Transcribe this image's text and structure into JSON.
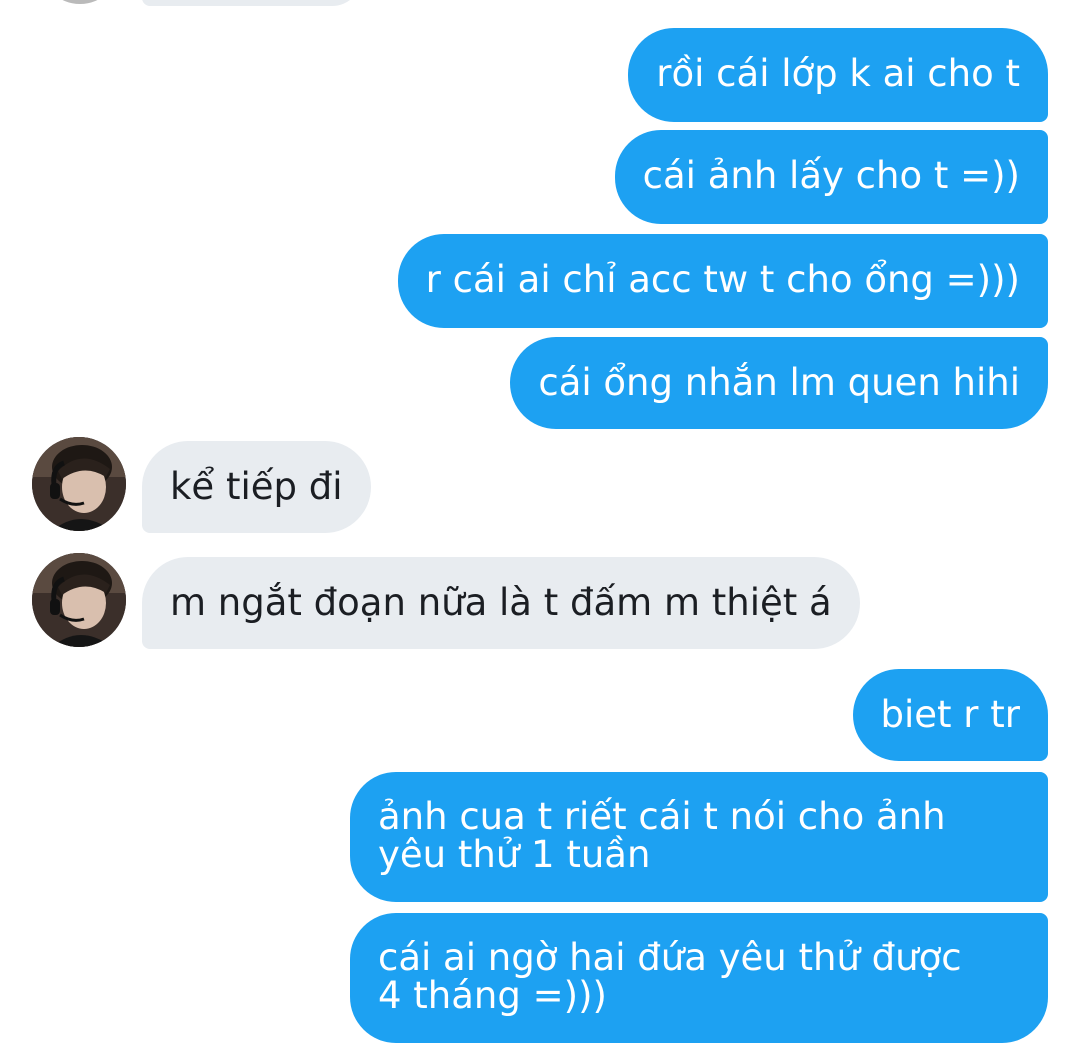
{
  "conversation": {
    "messages": [
      {
        "id": "m1",
        "side": "out",
        "text": "rồi cái lớp k ai cho t"
      },
      {
        "id": "m2",
        "side": "out",
        "text": "cái ảnh lấy cho t =))"
      },
      {
        "id": "m3",
        "side": "out",
        "text": "r cái ai chỉ acc tw t cho ổng =)))"
      },
      {
        "id": "m4",
        "side": "out",
        "text": "cái ổng nhắn lm quen hihi"
      },
      {
        "id": "m5",
        "side": "in",
        "text": "kể tiếp đi"
      },
      {
        "id": "m6",
        "side": "in",
        "text": "m ngắt đoạn nữa là t đấm m thiệt á"
      },
      {
        "id": "m7",
        "side": "out",
        "text": "biet r tr"
      },
      {
        "id": "m8",
        "side": "out",
        "text": "ảnh  cua t riết cái t nói cho ảnh yêu thử 1 tuần"
      },
      {
        "id": "m9",
        "side": "out",
        "text": "cái ai ngờ hai đứa yêu thử được 4 tháng =)))"
      }
    ]
  },
  "colors": {
    "outgoing_bubble": "#1da1f2",
    "incoming_bubble": "#e8ecf0",
    "outgoing_text": "#ffffff",
    "incoming_text": "#1b1e23",
    "background": "#ffffff"
  },
  "icons": {
    "contact_avatar": "avatar"
  }
}
